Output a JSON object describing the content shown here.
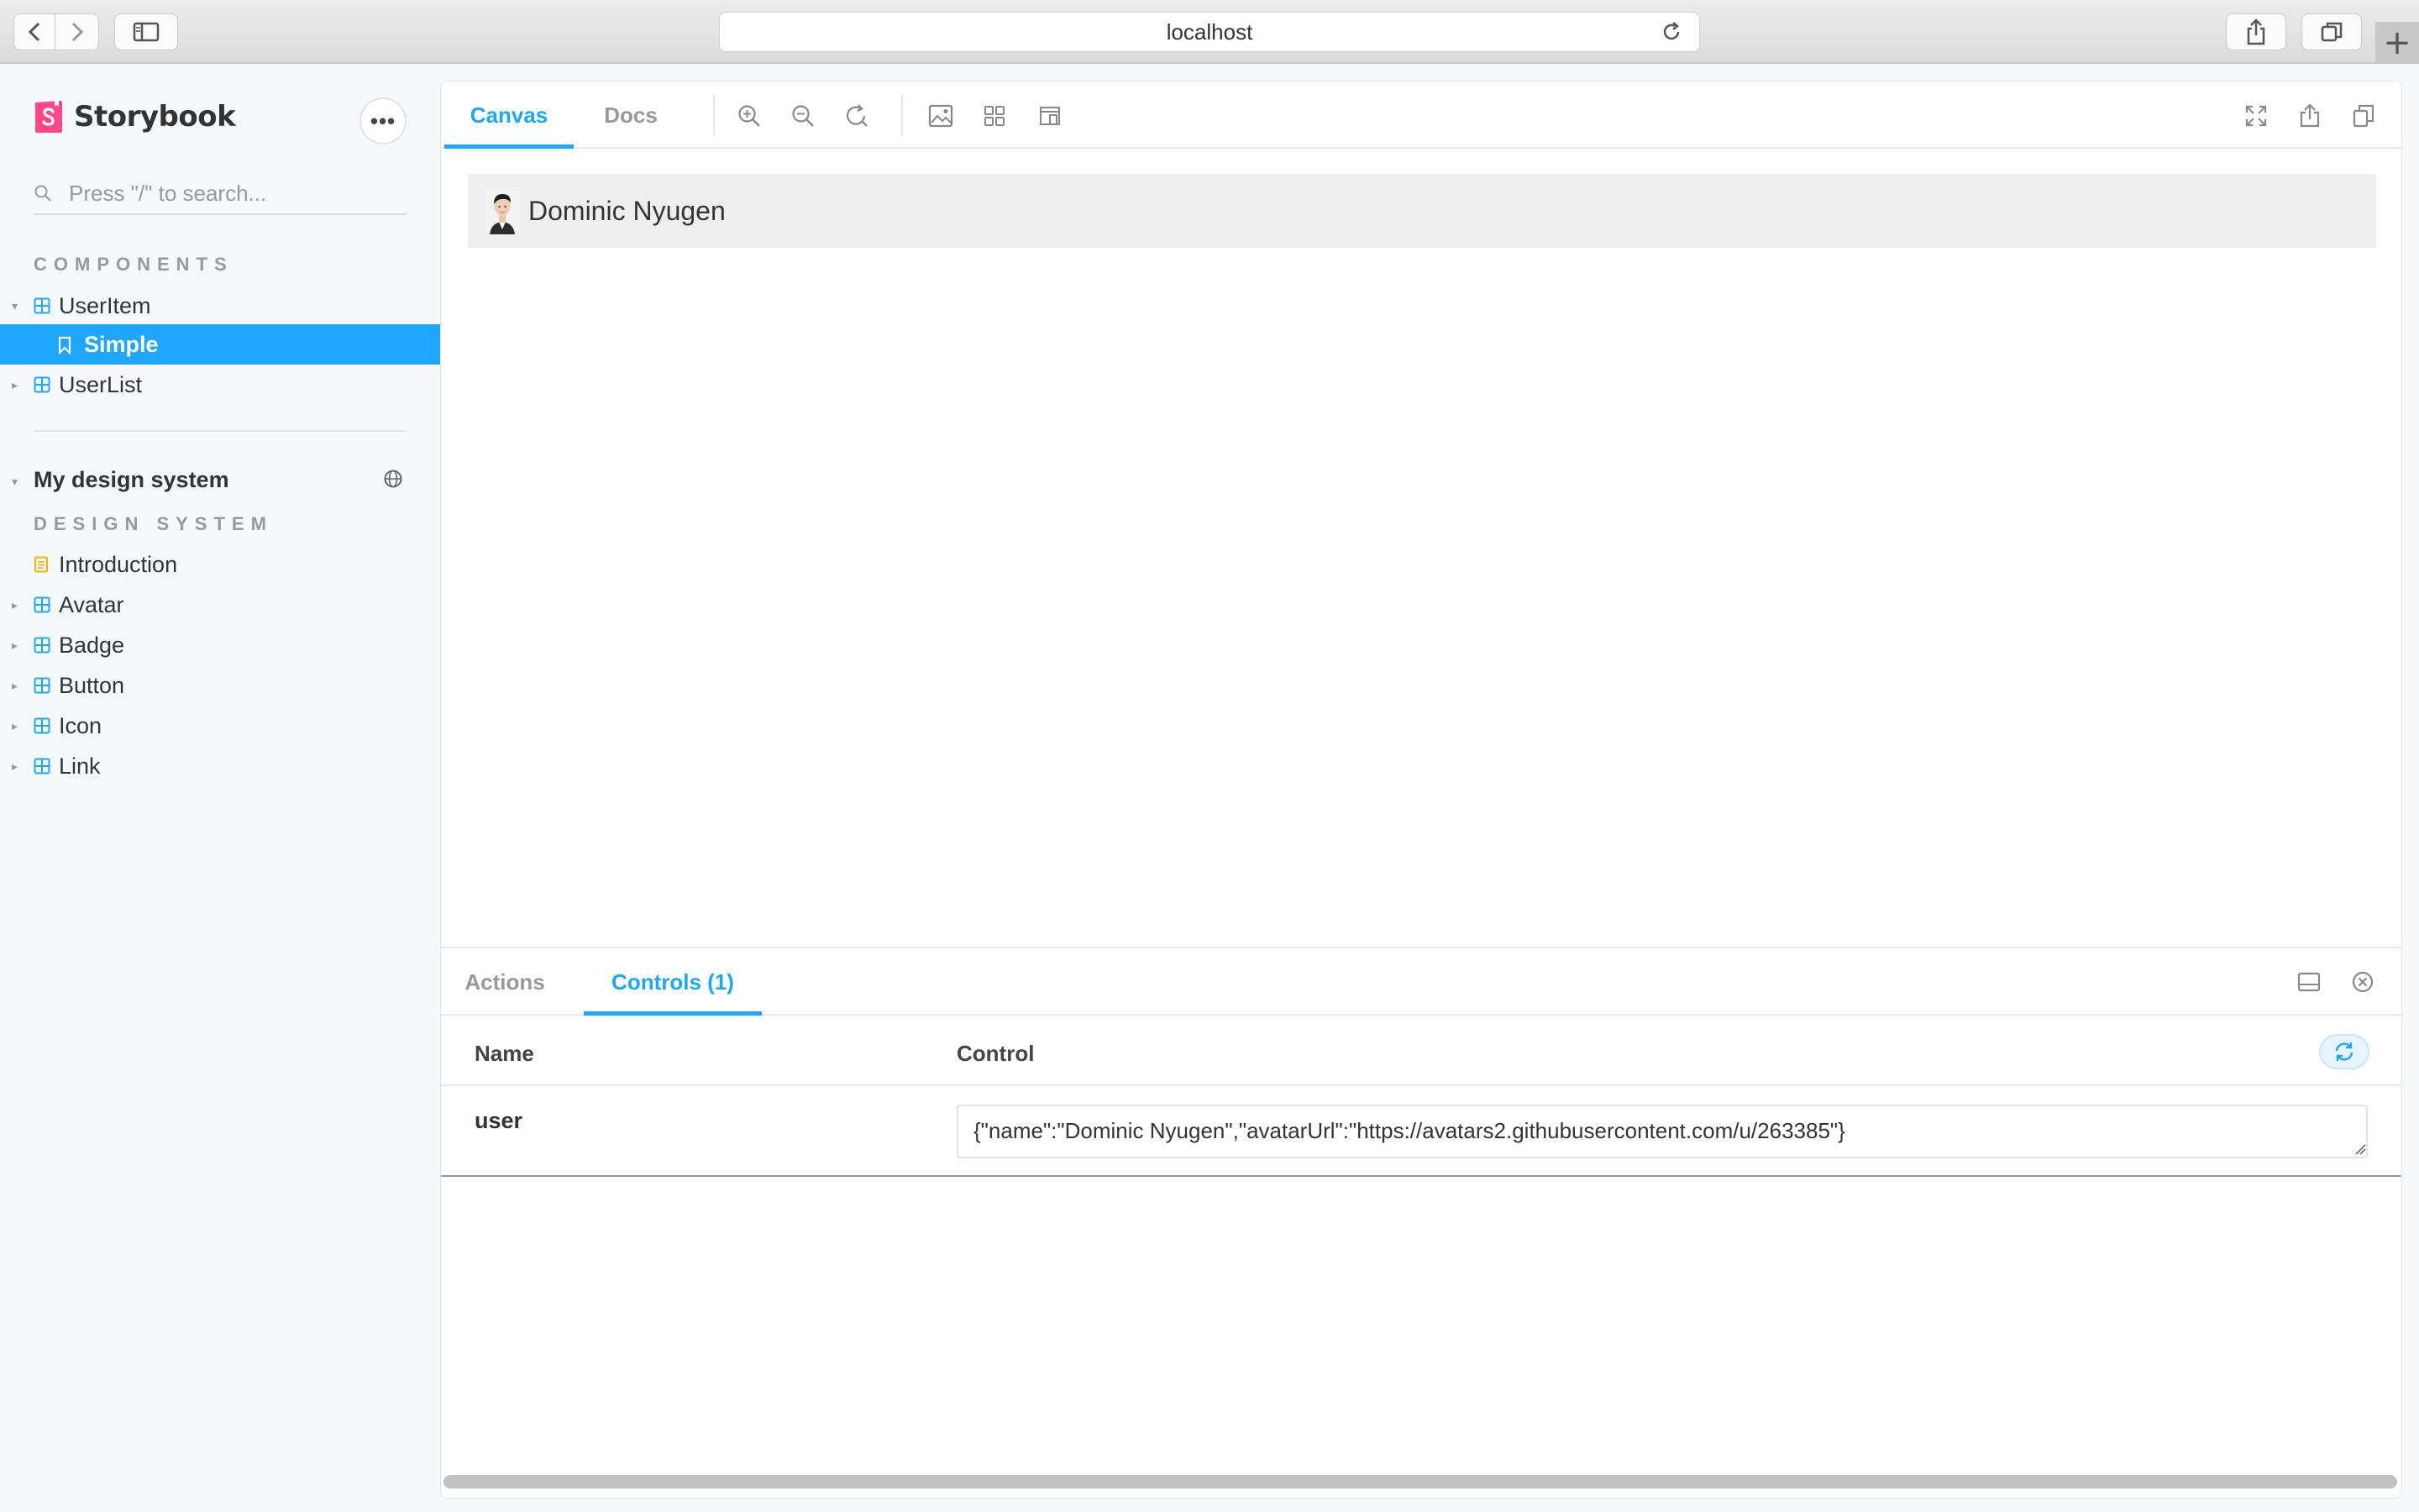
{
  "browser": {
    "url": "localhost",
    "new_tab": "+"
  },
  "sidebar": {
    "brand": "Storybook",
    "menu_label": "•••",
    "search_placeholder": "Press \"/\" to search...",
    "components_heading": "COMPONENTS",
    "components": [
      {
        "label": "UserItem",
        "expanded": true
      },
      {
        "label": "Simple",
        "selected": true
      },
      {
        "label": "UserList",
        "expanded": false
      }
    ],
    "ref_title": "My design system",
    "design_system_heading": "DESIGN SYSTEM",
    "design_system_items": [
      {
        "label": "Introduction",
        "icon": "document-icon"
      },
      {
        "label": "Avatar",
        "icon": "component-icon"
      },
      {
        "label": "Badge",
        "icon": "component-icon"
      },
      {
        "label": "Button",
        "icon": "component-icon"
      },
      {
        "label": "Icon",
        "icon": "component-icon"
      },
      {
        "label": "Link",
        "icon": "component-icon"
      }
    ]
  },
  "toolbar": {
    "tabs": [
      {
        "label": "Canvas",
        "active": true
      },
      {
        "label": "Docs",
        "active": false
      }
    ]
  },
  "canvas": {
    "user_name": "Dominic Nyugen"
  },
  "addons": {
    "tabs": [
      {
        "label": "Actions",
        "active": false
      },
      {
        "label": "Controls (1)",
        "active": true
      }
    ],
    "table": {
      "col_name": "Name",
      "col_control": "Control",
      "rows": [
        {
          "name": "user",
          "value": "{\"name\":\"Dominic Nyugen\",\"avatarUrl\":\"https://avatars2.githubusercontent.com/u/263385\"}"
        }
      ]
    }
  },
  "colors": {
    "accent": "#1ea7fd",
    "brand": "#ff4785"
  }
}
